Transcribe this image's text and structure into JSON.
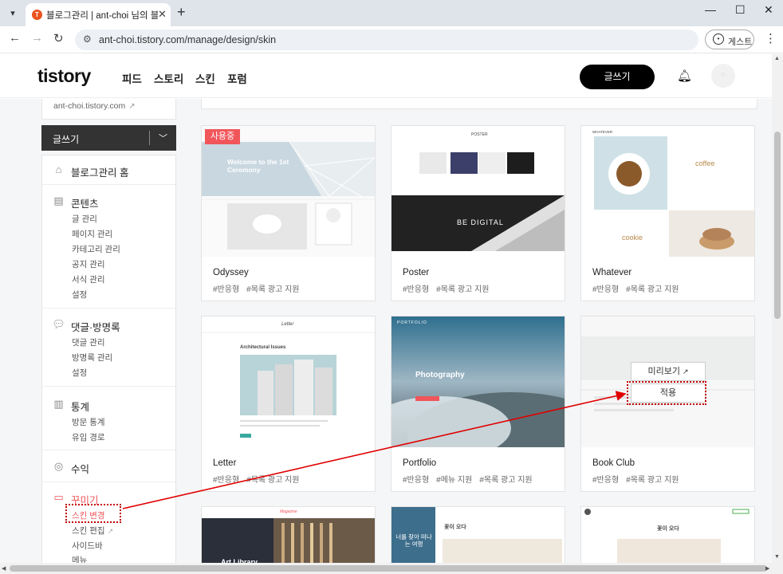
{
  "browser": {
    "tab_title": "블로그관리 | ant-choi 님의 블로그",
    "tab_favicon": "T",
    "url": "ant-choi.tistory.com/manage/design/skin",
    "guest_label": "게스트"
  },
  "header": {
    "logo": "tistory",
    "nav": [
      "피드",
      "스토리",
      "스킨",
      "포럼"
    ],
    "write_label": "글쓰기"
  },
  "sidebar": {
    "blog_url": "ant-choi.tistory.com",
    "write_label": "글쓰기",
    "home": "블로그관리 홈",
    "contents": {
      "title": "콘텐츠",
      "items": [
        "글 관리",
        "페이지 관리",
        "카테고리 관리",
        "공지 관리",
        "서식 관리",
        "설정"
      ]
    },
    "comments": {
      "title": "댓글·방명록",
      "items": [
        "댓글 관리",
        "방명록 관리",
        "설정"
      ]
    },
    "stats": {
      "title": "통계",
      "items": [
        "방문 통계",
        "유입 경로"
      ]
    },
    "revenue": "수익",
    "decorate": {
      "title": "꾸미기",
      "items": [
        "스킨 변경",
        "스킨 편집",
        "사이드바",
        "메뉴"
      ]
    }
  },
  "skins": [
    {
      "name": "Odyssey",
      "tags": [
        "#반응형",
        "#목록 광고 지원"
      ],
      "badge": "사용중",
      "preview_text": "Welcome to the 1st Ceremony"
    },
    {
      "name": "Poster",
      "tags": [
        "#반응형",
        "#목록 광고 지원"
      ],
      "preview_text": "BE DIGITAL",
      "preview_header": "POSTER"
    },
    {
      "name": "Whatever",
      "tags": [
        "#반응형",
        "#목록 광고 지원"
      ],
      "preview_text": "coffee",
      "preview_text2": "cookie",
      "preview_header": "WHATEVER"
    },
    {
      "name": "Letter",
      "tags": [
        "#반응형",
        "#목록 광고 지원"
      ],
      "preview_text": "Architectural Issues",
      "preview_header": "Letter"
    },
    {
      "name": "Portfolio",
      "tags": [
        "#반응형",
        "#메뉴 지원",
        "#목록 광고 지원"
      ],
      "preview_text": "Photography",
      "preview_header": "PORTFOLIO"
    },
    {
      "name": "Book Club",
      "tags": [
        "#반응형",
        "#목록 광고 지원"
      ],
      "preview_btn": "미리보기",
      "apply_btn": "적용"
    },
    {
      "name": "",
      "tags": [],
      "preview_text": "Art Library",
      "preview_header": "Magazine"
    },
    {
      "name": "",
      "tags": [],
      "preview_text": "너를 찾아 떠나는 여행",
      "preview_text2": "꽃이 오다"
    },
    {
      "name": "",
      "tags": [],
      "preview_text": "꽃이 오다"
    }
  ],
  "colors": {
    "accent": "#f1565b",
    "annotation": "#c00000",
    "dark": "#333333"
  }
}
